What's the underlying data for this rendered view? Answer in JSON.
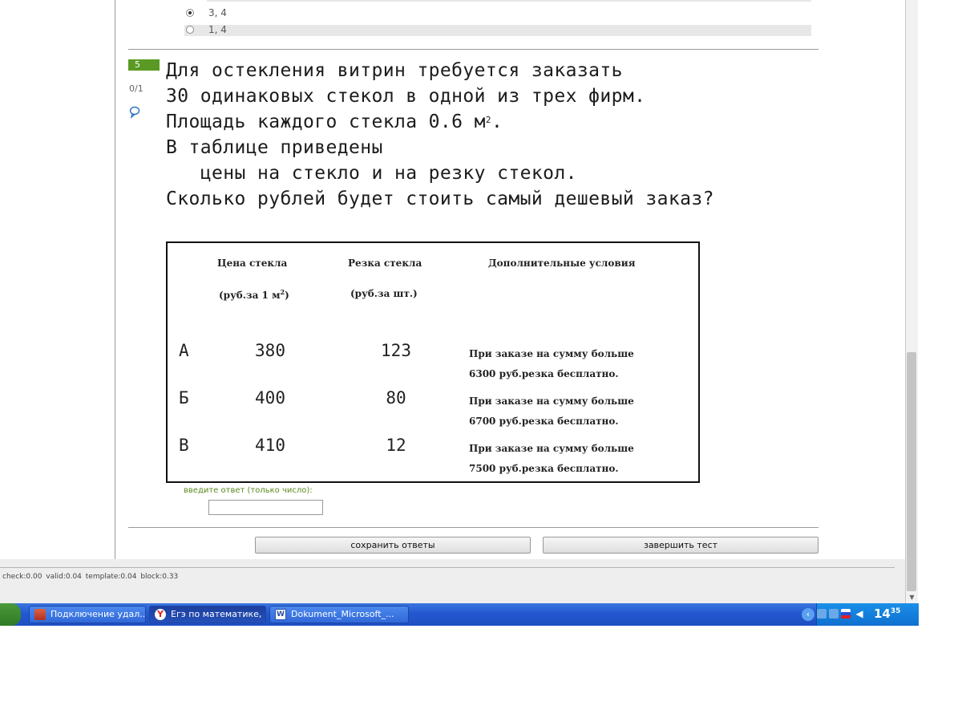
{
  "previous_question": {
    "options": [
      {
        "label": "3, 4",
        "selected": true
      },
      {
        "label": "1, 4",
        "selected": false
      }
    ]
  },
  "question": {
    "number": "5",
    "score": "0/1",
    "lines": [
      "Для остекления витрин требуется заказать",
      "30 одинаковых стекол в одной из трех фирм.",
      "Площадь каждого стекла 0.6 м",
      "В таблице приведены",
      "   цены на стекло и на резку стекол.",
      "Сколько рублей будет стоить самый дешевый заказ?"
    ],
    "area_superscript": "2",
    "area_suffix": ".",
    "table": {
      "headers": {
        "price_title": "Цена стекла",
        "price_unit": "(руб.за 1 м",
        "price_unit_sup": "2",
        "price_unit_close": ")",
        "cut_title": "Резка стекла",
        "cut_unit": "(руб.за шт.)",
        "conditions_title": "Дополнительные условия"
      },
      "rows": [
        {
          "firm": "А",
          "price": "380",
          "cut": "123",
          "cond_line1": "При заказе на сумму больше",
          "cond_line2": "6300 руб.резка бесплатно."
        },
        {
          "firm": "Б",
          "price": "400",
          "cut": "80",
          "cond_line1": "При заказе на сумму больше",
          "cond_line2": "6700 руб.резка бесплатно."
        },
        {
          "firm": "В",
          "price": "410",
          "cut": "12",
          "cond_line1": "При заказе на сумму больше",
          "cond_line2": "7500 руб.резка бесплатно."
        }
      ]
    },
    "answer_label": "введите ответ (только число):",
    "answer_value": ""
  },
  "buttons": {
    "save": "сохранить ответы",
    "finish": "завершить тест"
  },
  "footer": {
    "debug": "check:0.00  valid:0.04  template:0.04  block:0.33"
  },
  "taskbar": {
    "start": "",
    "tasks": [
      {
        "label": "Подключение удал...",
        "icon": "remote-desktop-icon",
        "active": false
      },
      {
        "label": "Егэ по математике, ...",
        "icon": "yandex-browser-icon",
        "active": true
      },
      {
        "label": "Dokument_Microsoft_...",
        "icon": "word-document-icon",
        "active": false
      }
    ],
    "clock_hour": "14",
    "clock_min": "35"
  },
  "colors": {
    "accent_green": "#5a9a24",
    "taskbar_blue": "#2458d0"
  }
}
